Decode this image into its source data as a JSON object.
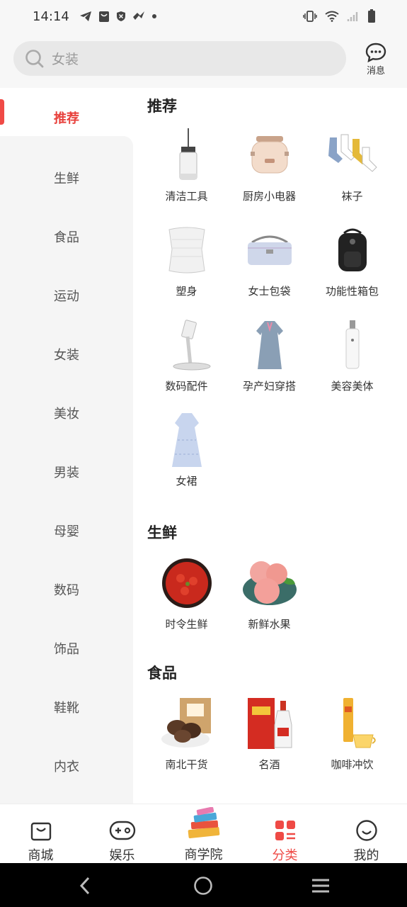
{
  "status_bar": {
    "time": "14:14",
    "left_icons": [
      "telegram-icon",
      "bag-icon",
      "shield-icon",
      "feather-icon",
      "dot-icon"
    ],
    "right_icons": [
      "vibrate-icon",
      "wifi-icon",
      "signal-icon",
      "battery-icon"
    ]
  },
  "header": {
    "search_placeholder": "女装",
    "message_label": "消息"
  },
  "sidebar": {
    "items": [
      {
        "label": "推荐",
        "active": true
      },
      {
        "label": "生鲜"
      },
      {
        "label": "食品"
      },
      {
        "label": "运动"
      },
      {
        "label": "女装"
      },
      {
        "label": "美妆"
      },
      {
        "label": "男装"
      },
      {
        "label": "母婴"
      },
      {
        "label": "数码"
      },
      {
        "label": "饰品"
      },
      {
        "label": "鞋靴"
      },
      {
        "label": "内衣"
      }
    ]
  },
  "content": {
    "sections": [
      {
        "title": "推荐",
        "items": [
          {
            "label": "清洁工具",
            "icon": "mop-icon"
          },
          {
            "label": "厨房小电器",
            "icon": "cooker-icon"
          },
          {
            "label": "袜子",
            "icon": "socks-icon"
          },
          {
            "label": "塑身",
            "icon": "shapewear-icon"
          },
          {
            "label": "女士包袋",
            "icon": "handbag-icon"
          },
          {
            "label": "功能性箱包",
            "icon": "backpack-icon"
          },
          {
            "label": "数码配件",
            "icon": "phone-stand-icon"
          },
          {
            "label": "孕产妇穿搭",
            "icon": "maternity-dress-icon"
          },
          {
            "label": "美容美体",
            "icon": "beauty-device-icon"
          },
          {
            "label": "女裙",
            "icon": "dress-icon"
          }
        ]
      },
      {
        "title": "生鲜",
        "items": [
          {
            "label": "时令生鲜",
            "icon": "crayfish-icon"
          },
          {
            "label": "新鲜水果",
            "icon": "peach-icon"
          }
        ]
      },
      {
        "title": "食品",
        "items": [
          {
            "label": "南北干货",
            "icon": "mushroom-icon"
          },
          {
            "label": "名酒",
            "icon": "liquor-icon"
          },
          {
            "label": "咖啡冲饮",
            "icon": "coffee-icon"
          }
        ]
      }
    ]
  },
  "tabbar": {
    "tabs": [
      {
        "label": "商城",
        "icon": "shopping-bag-icon"
      },
      {
        "label": "娱乐",
        "icon": "gamepad-icon"
      },
      {
        "label": "商学院",
        "icon": "books-icon"
      },
      {
        "label": "分类",
        "icon": "category-icon",
        "active": true
      },
      {
        "label": "我的",
        "icon": "smile-icon"
      }
    ]
  },
  "colors": {
    "accent": "#ef4a45",
    "header_bg": "#f7f7f7",
    "sidebar_bg": "#f5f5f5"
  }
}
